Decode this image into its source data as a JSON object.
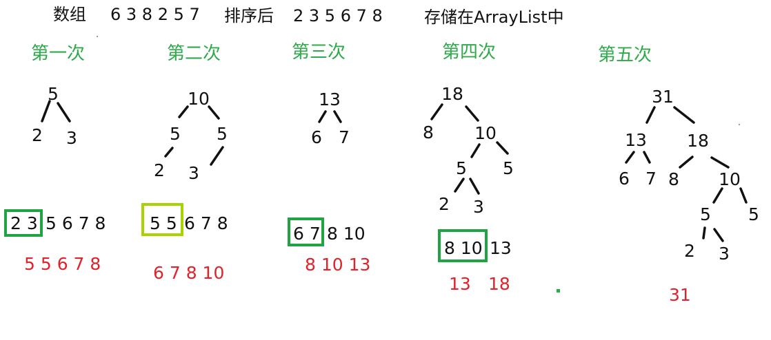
{
  "header": {
    "array_label": "数组",
    "array_values": "6 3 8 2 5 7",
    "sorted_label": "排序后",
    "sorted_values": "2 3 5 6 7 8",
    "storage_note": "存储在ArrayList中"
  },
  "steps": [
    {
      "title": "第一次",
      "tree": [
        "5",
        "2",
        "3"
      ],
      "boxed": "2 3",
      "rest": "5 6 7 8",
      "result": "5 5 6 7 8"
    },
    {
      "title": "第二次",
      "tree": [
        "10",
        "5",
        "5",
        "2",
        "3"
      ],
      "boxed": "5 5",
      "rest": "6 7 8",
      "result": "6 7 8 10"
    },
    {
      "title": "第三次",
      "tree": [
        "13",
        "6",
        "7"
      ],
      "boxed": "6 7",
      "rest": "8 10",
      "result": "8 10 13"
    },
    {
      "title": "第四次",
      "tree": [
        "18",
        "8",
        "10",
        "5",
        "5",
        "2",
        "3"
      ],
      "boxed": "8 10",
      "rest": "13",
      "result_a": "13",
      "result_b": "18"
    },
    {
      "title": "第五次",
      "tree": [
        "31",
        "13",
        "18",
        "6",
        "7",
        "8",
        "10",
        "5",
        "5",
        "2",
        "3"
      ],
      "result": "31"
    }
  ],
  "colors": {
    "stage_title": "#2faa4a",
    "result_text": "#e0222a",
    "box_green": "#1fa343",
    "box_lime": "#a6d400",
    "edge": "#111111"
  }
}
